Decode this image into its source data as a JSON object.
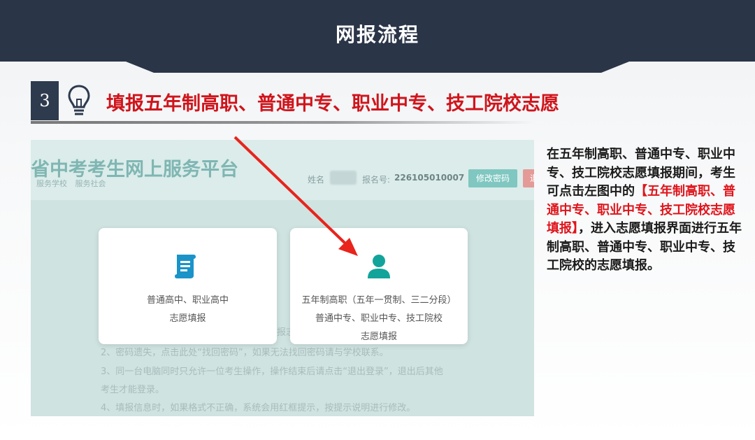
{
  "header": {
    "title": "网报流程",
    "bg_color": "#2b3548"
  },
  "step": {
    "number": "3",
    "icon": "lightbulb-icon",
    "title": "填报五年制高职、普通中专、职业中专、技工院校志愿",
    "title_color": "#d0141b"
  },
  "screenshot": {
    "site_title": "省中考考生网上服务平台",
    "site_subtitle": "服务学校  服务社会",
    "name_label": "姓名",
    "reg_label": "报名号:",
    "reg_value": "226105010007",
    "change_password_label": "修改密码",
    "logout_label": "退",
    "cards": [
      {
        "icon": "document-scroll-icon",
        "line1": "普通高中、职业高中",
        "line2": "志愿填报",
        "line3": ""
      },
      {
        "icon": "user-icon",
        "line1": "五年制高职（五年一贯制、三二分段）",
        "line2": "普通中专、职业中专、技工院校",
        "line3": "志愿填报"
      }
    ],
    "notices": [
      "报志",
      "2、密码遗失，点击此处“找回密码”，如果无法找回密码请与学校联系。",
      "3、同一台电脑同时只允许一位考生操作，操作结束后请点击“退出登录”，退出后其他",
      "考生才能登录。",
      "4、填报信息时，如果格式不正确，系统会用红框提示，按提示说明进行修改。"
    ]
  },
  "description": {
    "part1": "在五年制高职、普通中专、职业中专、技工院校志愿填报期间，考生可点击左图中的",
    "highlight": "【五年制高职、普通中专、职业中专、技工院校志愿填报】",
    "part2": "，进入志愿填报界面进行五年制高职、普通中专、职业中专、技工院校的志愿填报。",
    "highlight_color": "#e0141b"
  },
  "accent_color": "#e8241c"
}
